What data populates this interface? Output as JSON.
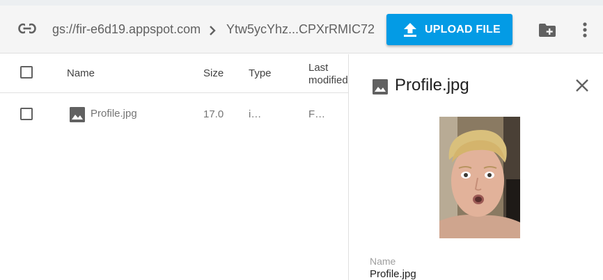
{
  "toolbar": {
    "path_root": "gs://fir-e6d19.appspot.com",
    "path_leaf": "Ytw5ycYhz...CPXrRMIC72",
    "upload_label": "UPLOAD FILE",
    "accent_color": "#039be5"
  },
  "icons": {
    "link": "link-icon",
    "breadcrumb_separator": "chevron-right-icon",
    "upload": "upload-icon",
    "new_folder": "create-folder-icon",
    "more": "more-vert-icon",
    "file_type": "image-icon",
    "close": "close-icon"
  },
  "table": {
    "columns": [
      "Name",
      "Size",
      "Type",
      "Last",
      "modified"
    ],
    "rows": [
      {
        "name": "Profile.jpg",
        "size": "17.0",
        "type": "i…",
        "modified": "F…"
      }
    ]
  },
  "panel": {
    "title": "Profile.jpg",
    "name_label": "Name",
    "name_value": "Profile.jpg"
  }
}
